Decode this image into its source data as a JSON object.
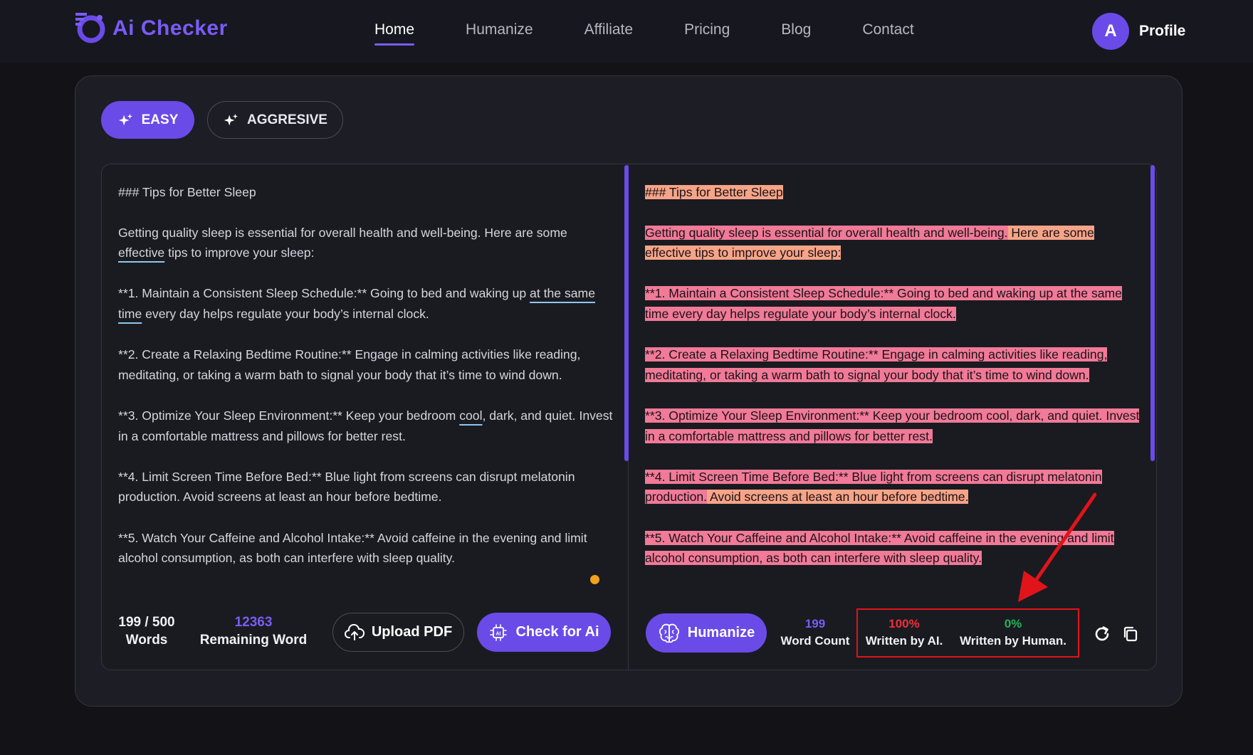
{
  "brand": {
    "name": "Ai Checker",
    "accent": "#6a4be8"
  },
  "nav": {
    "items": [
      "Home",
      "Humanize",
      "Affiliate",
      "Pricing",
      "Blog",
      "Contact"
    ],
    "active": "Home"
  },
  "profile": {
    "initial": "A",
    "label": "Profile"
  },
  "modes": {
    "easy": "EASY",
    "aggressive": "AGGRESIVE",
    "selected": "EASY"
  },
  "input": {
    "heading": "### Tips for Better Sleep",
    "p1a": "Getting quality sleep is essential for overall health and well-being. Here are some ",
    "p1b": "effective",
    "p1c": " tips to improve your sleep:",
    "p2a": "**1. Maintain a Consistent Sleep Schedule:** Going to bed and waking up ",
    "p2b": "at the same time",
    "p2c": " every day helps regulate your body’s internal clock.",
    "p3": "**2. Create a Relaxing Bedtime Routine:** Engage in calming activities like reading, meditating, or taking a warm bath to signal your body that it’s time to wind down.",
    "p4a": "**3. Optimize Your Sleep Environment:** Keep your bedroom ",
    "p4b": "cool",
    "p4c": ", dark, and quiet. Invest in a comfortable mattress and pillows for better rest.",
    "p5": "**4. Limit Screen Time Before Bed:** Blue light from screens can disrupt melatonin production. Avoid screens at least an hour before bedtime.",
    "p6": "**5. Watch Your Caffeine and Alcohol Intake:** Avoid caffeine in the evening and limit alcohol consumption, as both can interfere with sleep quality."
  },
  "output": {
    "heading": "### Tips for Better Sleep",
    "p1a": "Getting quality sleep is essential for overall health and well-being.",
    "p1b": " Here are some effective tips to improve your sleep:",
    "p2": "**1. Maintain a Consistent Sleep Schedule:** Going to bed and waking up at the same time every day helps regulate your body’s internal clock.",
    "p3": "**2. Create a Relaxing Bedtime Routine:** Engage in calming activities like reading, meditating, or taking a warm bath to signal your body that it’s time to wind down.",
    "p4": "**3. Optimize Your Sleep Environment:** Keep your bedroom cool, dark, and quiet. Invest in a comfortable mattress and pillows for better rest.",
    "p5a": "**4. Limit Screen Time Before Bed:** Blue light from screens can disrupt melatonin production.",
    "p5b": " Avoid screens at least an hour before bedtime.",
    "p6": "**5. Watch Your Caffeine and Alcohol Intake:** Avoid caffeine in the evening and limit alcohol consumption, as both can interfere with sleep quality."
  },
  "stats": {
    "words": "199 / 500",
    "words_label": "Words",
    "remaining": "12363",
    "remaining_label": "Remaining Word",
    "word_count": "199",
    "word_count_label": "Word Count"
  },
  "buttons": {
    "upload": "Upload PDF",
    "check": "Check for Ai",
    "humanize": "Humanize"
  },
  "result": {
    "ai_pct": "100%",
    "ai_label": "Written by AI.",
    "human_pct": "0%",
    "human_label": "Written by Human."
  },
  "colors": {
    "highlight_pink": "#f07a97",
    "highlight_peach": "#f6a487",
    "ai_red": "#ef2f3a",
    "human_green": "#22b35a",
    "callout_red": "#e0141a"
  }
}
